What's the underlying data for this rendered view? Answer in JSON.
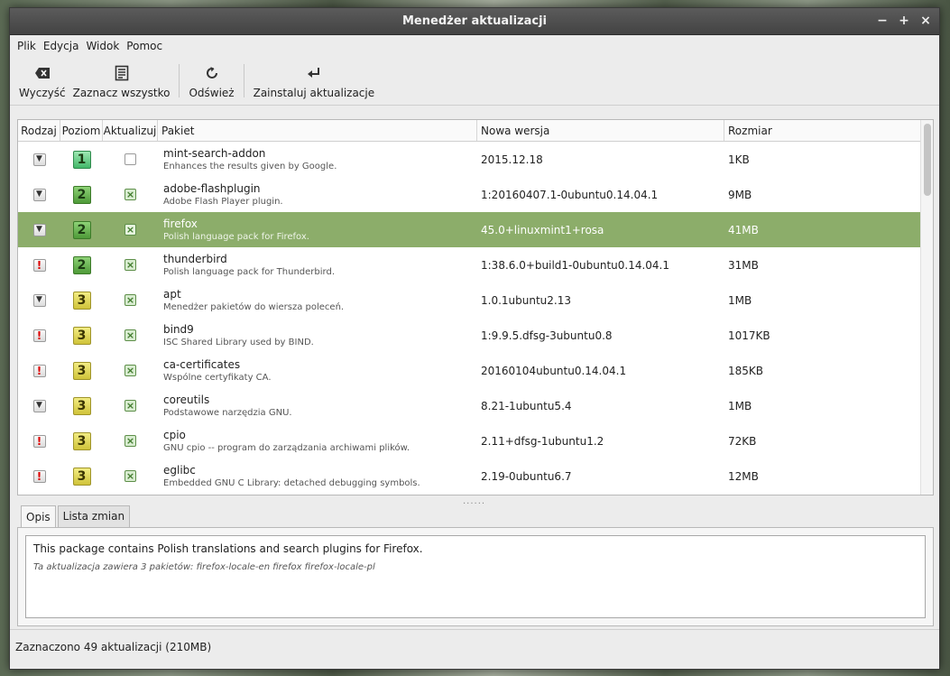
{
  "window": {
    "title": "Menedżer aktualizacji",
    "btn_min": "−",
    "btn_max": "+",
    "btn_close": "×"
  },
  "menu": [
    "Plik",
    "Edycja",
    "Widok",
    "Pomoc"
  ],
  "toolbar": {
    "clear_label": "Wyczyść",
    "select_all_label": "Zaznacz wszystko",
    "refresh_label": "Odśwież",
    "install_label": "Zainstaluj aktualizacje"
  },
  "columns": {
    "type": "Rodzaj",
    "level": "Poziom",
    "update": "Aktualizuj",
    "package": "Pakiet",
    "new_version": "Nowa wersja",
    "size": "Rozmiar"
  },
  "rows": [
    {
      "type": "package",
      "level": "1",
      "checked": false,
      "name": "mint-search-addon",
      "desc": "Enhances the results given by Google.",
      "version": "2015.12.18",
      "size": "1KB"
    },
    {
      "type": "package",
      "level": "2",
      "checked": true,
      "name": "adobe-flashplugin",
      "desc": "Adobe Flash Player plugin.",
      "version": "1:20160407.1-0ubuntu0.14.04.1",
      "size": "9MB"
    },
    {
      "type": "package",
      "level": "2",
      "checked": true,
      "name": "firefox",
      "desc": "Polish language pack for Firefox.",
      "version": "45.0+linuxmint1+rosa",
      "size": "41MB",
      "selected": true
    },
    {
      "type": "security",
      "level": "2",
      "checked": true,
      "name": "thunderbird",
      "desc": "Polish language pack for Thunderbird.",
      "version": "1:38.6.0+build1-0ubuntu0.14.04.1",
      "size": "31MB"
    },
    {
      "type": "package",
      "level": "3",
      "checked": true,
      "name": "apt",
      "desc": "Menedżer pakietów do wiersza poleceń.",
      "version": "1.0.1ubuntu2.13",
      "size": "1MB"
    },
    {
      "type": "security",
      "level": "3",
      "checked": true,
      "name": "bind9",
      "desc": "ISC Shared Library used by BIND.",
      "version": "1:9.9.5.dfsg-3ubuntu0.8",
      "size": "1017KB"
    },
    {
      "type": "security",
      "level": "3",
      "checked": true,
      "name": "ca-certificates",
      "desc": "Wspólne certyfikaty CA.",
      "version": "20160104ubuntu0.14.04.1",
      "size": "185KB"
    },
    {
      "type": "package",
      "level": "3",
      "checked": true,
      "name": "coreutils",
      "desc": "Podstawowe narzędzia GNU.",
      "version": "8.21-1ubuntu5.4",
      "size": "1MB"
    },
    {
      "type": "security",
      "level": "3",
      "checked": true,
      "name": "cpio",
      "desc": "GNU cpio -- program do zarządzania archiwami plików.",
      "version": "2.11+dfsg-1ubuntu1.2",
      "size": "72KB"
    },
    {
      "type": "security",
      "level": "3",
      "checked": true,
      "name": "eglibc",
      "desc": "Embedded GNU C Library: detached debugging symbols.",
      "version": "2.19-0ubuntu6.7",
      "size": "12MB"
    }
  ],
  "tabs": {
    "description": "Opis",
    "changelog": "Lista zmian"
  },
  "description": {
    "main": "This package contains Polish translations and search plugins for Firefox.",
    "sub": "Ta aktualizacja zawiera 3 pakietów:  firefox-locale-en firefox firefox-locale-pl"
  },
  "status": "Zaznaczono 49 aktualizacji (210MB)",
  "colors": {
    "selected_row": "#8cad6a",
    "titlebar": "#4a4a4a"
  },
  "icons": {
    "package": "arrow-down-icon",
    "security": "exclamation-icon"
  }
}
